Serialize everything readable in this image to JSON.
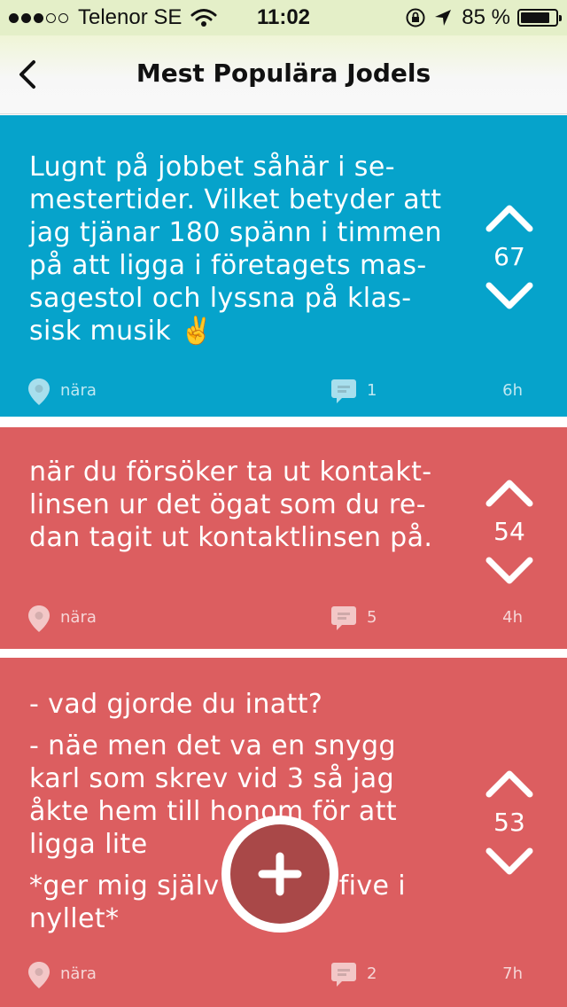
{
  "status_bar": {
    "carrier": "Telenor SE",
    "time": "11:02",
    "battery": "85 %",
    "battery_level": 0.85,
    "signal_bars": 3,
    "icons": [
      "wifi-icon",
      "rotation-lock-icon",
      "location-arrow-icon",
      "battery-icon"
    ]
  },
  "nav": {
    "title": "Mest Populära Jodels",
    "back_icon": "chevron-left-icon"
  },
  "colors": {
    "status_bar_bg": "#e4efc8",
    "card_blue": "#06a3cb",
    "card_red": "#dc5e60",
    "fab": "#a94848"
  },
  "posts": [
    {
      "color": "#06a3cb",
      "paragraphs": [
        "Lugnt på jobbet såhär i se-\nmestertider. Vilket betyder att\njag tjänar 180 spänn i timmen\npå att ligga i företagets mas-\nsagestol och lyssna på klas-\nsisk musik ✌️"
      ],
      "votes": "67",
      "location": "nära",
      "comments": "1",
      "age": "6h"
    },
    {
      "color": "#dc5e60",
      "paragraphs": [
        "när du försöker ta ut kontakt-\nlinsen ur det ögat som du re-\ndan tagit ut kontaktlinsen på."
      ],
      "votes": "54",
      "location": "nära",
      "comments": "5",
      "age": "4h"
    },
    {
      "color": "#dc5e60",
      "paragraphs": [
        "- vad gjorde du inatt?",
        "- näe men det va en snygg\nkarl som skrev vid 3 så jag\nåkte hem till honom för att\nligga lite",
        "*ger mig själv en high five i\nnyllet*"
      ],
      "votes": "53",
      "location": "nära",
      "comments": "2",
      "age": "7h"
    }
  ],
  "fab": {
    "icon": "plus-icon"
  }
}
